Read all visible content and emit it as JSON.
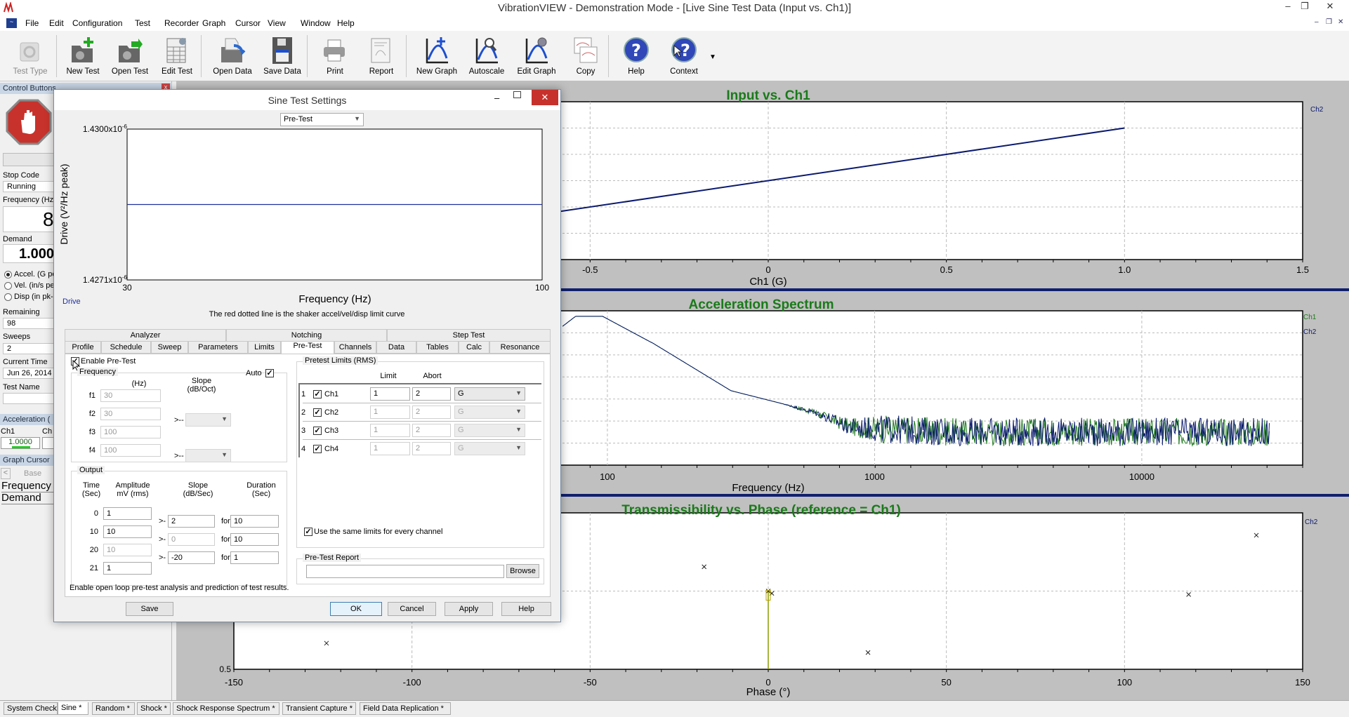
{
  "window": {
    "title": "VibrationVIEW - Demonstration Mode - [Live Sine Test Data (Input vs. Ch1)]",
    "minimize": "–",
    "restore": "❐",
    "close": "✕",
    "mdi_minimize": "–",
    "mdi_restore": "❐",
    "mdi_close": "✕"
  },
  "menu": [
    "File",
    "Edit",
    "Configuration",
    "Test",
    "Recorder",
    "Graph",
    "Cursor",
    "View",
    "Window",
    "Help"
  ],
  "toolbar": [
    {
      "label": "Test Type",
      "icon": "test-type-icon",
      "disabled": true
    },
    {
      "label": "New Test",
      "icon": "new-test-icon"
    },
    {
      "label": "Open Test",
      "icon": "open-test-icon"
    },
    {
      "label": "Edit Test",
      "icon": "edit-test-icon"
    },
    {
      "label": "Open Data",
      "icon": "open-data-icon"
    },
    {
      "label": "Save Data",
      "icon": "save-data-icon"
    },
    {
      "label": "Print",
      "icon": "printer-icon"
    },
    {
      "label": "Report",
      "icon": "report-icon"
    },
    {
      "label": "New Graph",
      "icon": "new-graph-icon"
    },
    {
      "label": "Autoscale",
      "icon": "autoscale-icon"
    },
    {
      "label": "Edit Graph",
      "icon": "edit-graph-icon"
    },
    {
      "label": "Copy",
      "icon": "copy-icon"
    },
    {
      "label": "Help",
      "icon": "help-icon"
    },
    {
      "label": "Context",
      "icon": "context-help-icon"
    }
  ],
  "left_panel": {
    "header": "Control Buttons",
    "run_button": "R",
    "stop_code_label": "Stop Code",
    "stop_code": "Running",
    "frequency_label": "Frequency (Hz",
    "frequency": "8",
    "demand_label": "Demand",
    "demand": "1.000",
    "radios": [
      {
        "label": "Accel. (G pe",
        "checked": true
      },
      {
        "label": "Vel. (in/s pe",
        "checked": false
      },
      {
        "label": "Disp (in pk-p",
        "checked": false
      }
    ],
    "remaining_label": "Remaining",
    "remaining": "98",
    "sweeps_label": "Sweeps",
    "sweeps": "2",
    "current_time_label": "Current Time",
    "current_time": "Jun 26, 2014",
    "test_name_label": "Test Name",
    "test_name": "",
    "acceleration_header": "Acceleration (",
    "ch1_label": "Ch1",
    "ch2_label": "Ch",
    "ch1_value": "1.0000",
    "graph_cursor_header": "Graph Cursor",
    "cursor_prev": "<",
    "cursor_base": "Base",
    "cursor_frequency": "Frequency",
    "cursor_demand": "Demand"
  },
  "colors": {
    "title_green": "#1a7a1a",
    "ch1": "#1f7a1f",
    "ch2": "#0b1a6e",
    "cursor_line": "#8a9a00",
    "green_bar": "#22cc22"
  },
  "chart_data": [
    {
      "type": "line",
      "title": "Input vs. Ch1",
      "xlabel": "Ch1 (G)",
      "ylabel": "",
      "xlim": [
        -1.5,
        1.5
      ],
      "ylim": [
        -1.5,
        1.5
      ],
      "xticks": [
        "-0.5",
        "0",
        "0.5",
        "1.0",
        "1.5"
      ],
      "xtick_values": [
        -0.5,
        0,
        0.5,
        1.0,
        1.5
      ],
      "grid": true,
      "series": [
        {
          "name": "Ch2",
          "x": [
            -1.5,
            1.0
          ],
          "y": [
            -1.5,
            1.0
          ]
        }
      ]
    },
    {
      "type": "line",
      "title": "Acceleration Spectrum",
      "xlabel": "Frequency (Hz)",
      "ylabel": "",
      "x_scale": "log",
      "y_scale": "log",
      "xlim": [
        4,
        40000
      ],
      "ylim": [
        0.001,
        1
      ],
      "xticks": [
        "100",
        "1000",
        "10000"
      ],
      "xtick_values": [
        100,
        1000,
        10000
      ],
      "grid": true,
      "series": [
        {
          "name": "Ch1",
          "x": [
            68,
            76,
            96,
            149,
            290,
            612,
            800,
            2000,
            8000,
            30000
          ],
          "y": [
            0.5,
            0.78,
            0.78,
            0.23,
            0.028,
            0.0105,
            0.006,
            0.005,
            0.005,
            0.005
          ]
        },
        {
          "name": "Ch2",
          "x": [
            68,
            76,
            96,
            149,
            290,
            612,
            800,
            2000,
            8000,
            30000
          ],
          "y": [
            0.5,
            0.78,
            0.78,
            0.23,
            0.028,
            0.0105,
            0.006,
            0.005,
            0.005,
            0.005
          ]
        }
      ]
    },
    {
      "type": "scatter",
      "title": "Transmissibility vs. Phase (reference = Ch1)",
      "xlabel": "Phase (°)",
      "ylabel": "",
      "y_scale": "log",
      "xlim": [
        -150,
        150
      ],
      "ylim": [
        0.5,
        2
      ],
      "xticks": [
        "-150",
        "-100",
        "-50",
        "0",
        "50",
        "100",
        "150"
      ],
      "xtick_values": [
        -150,
        -100,
        -50,
        0,
        50,
        100,
        150
      ],
      "yticks": [
        "0.5"
      ],
      "ytick_values": [
        0.5
      ],
      "grid": true,
      "series": [
        {
          "name": "Ch2",
          "x": [
            -124,
            -18,
            0,
            1,
            28,
            118,
            137
          ],
          "y": [
            0.63,
            1.24,
            1.0,
            0.98,
            0.58,
            0.97,
            1.64
          ]
        }
      ],
      "cursor_phase": 0
    },
    {
      "type": "line",
      "title": "",
      "xlabel": "Frequency (Hz)",
      "ylabel": "Drive (V²/Hz peak)",
      "x_scale": "log",
      "xlim": [
        30,
        100
      ],
      "ylim": [
        1.4271e-06,
        1.43e-06
      ],
      "yticks": [
        "1.4300x10",
        "1.4271x10"
      ],
      "ytick_exp": "-6",
      "xticks": [
        "30",
        "100"
      ],
      "legend": "Drive",
      "series": [
        {
          "name": "Drive",
          "x": [
            30,
            100
          ],
          "y": [
            1.42855e-06,
            1.42855e-06
          ]
        }
      ]
    }
  ],
  "graph_legends": {
    "g1": [
      "Ch2"
    ],
    "g2": [
      "Ch1",
      "Ch2"
    ],
    "g3": [
      "Ch2"
    ]
  },
  "dialog": {
    "title": "Sine Test Settings",
    "view_select": "Pre-Test",
    "note": "The red dotted line is the shaker accel/vel/disp limit curve",
    "tabs_row1": [
      "Analyzer",
      "Notching",
      "Step Test"
    ],
    "tabs_row2": [
      "Profile",
      "Schedule",
      "Sweep",
      "Parameters",
      "Limits",
      "Pre-Test",
      "Channels",
      "Data",
      "Tables",
      "Calc",
      "Resonance"
    ],
    "active_tab": "Pre-Test",
    "enable_pretest": {
      "label": "Enable Pre-Test",
      "checked": true
    },
    "frequency": {
      "legend": "Frequency",
      "auto_label": "Auto",
      "auto_checked": true,
      "hz_header": "(Hz)",
      "slope_header": "Slope\n(dB/Oct)",
      "rows": [
        {
          "label": "f1",
          "value": "30"
        },
        {
          "label": "f2",
          "value": "30"
        },
        {
          "label": "f3",
          "value": "100"
        },
        {
          "label": "f4",
          "value": "100"
        }
      ],
      "arrow": ">--",
      "slope1": "",
      "slope2": ""
    },
    "output": {
      "legend": "Output",
      "time_header": "Time\n(Sec)",
      "amp_header": "Amplitude\nmV (rms)",
      "slope_header": "Slope\n(dB/Sec)",
      "duration_header": "Duration\n(Sec)",
      "rows": [
        {
          "time": "0",
          "amp": "1"
        },
        {
          "time": "10",
          "amp": "10"
        },
        {
          "time": "20",
          "amp": "10"
        },
        {
          "time": "21",
          "amp": "1"
        }
      ],
      "segments": [
        {
          "slope": "2",
          "duration": "10"
        },
        {
          "slope": "0",
          "duration": "10"
        },
        {
          "slope": "-20",
          "duration": "1"
        }
      ],
      "arrow": ">-",
      "for": "for"
    },
    "limits": {
      "legend": "Pretest Limits (RMS)",
      "limit_header": "Limit",
      "abort_header": "Abort",
      "rows": [
        {
          "n": "1",
          "ch": "Ch1",
          "checked": true,
          "limit": "1",
          "abort": "2",
          "unit": "G"
        },
        {
          "n": "2",
          "ch": "Ch2",
          "checked": true,
          "limit": "1",
          "abort": "2",
          "unit": "G"
        },
        {
          "n": "3",
          "ch": "Ch3",
          "checked": true,
          "limit": "1",
          "abort": "2",
          "unit": "G"
        },
        {
          "n": "4",
          "ch": "Ch4",
          "checked": true,
          "limit": "1",
          "abort": "2",
          "unit": "G"
        }
      ],
      "same_limits": {
        "label": "Use the same limits for every channel",
        "checked": true
      }
    },
    "report": {
      "legend": "Pre-Test Report",
      "path": "",
      "browse": "Browse"
    },
    "status": "Enable open loop pre-test analysis and prediction of test results.",
    "buttons": {
      "save": "Save",
      "ok": "OK",
      "cancel": "Cancel",
      "apply": "Apply",
      "help": "Help"
    }
  },
  "bottom_tabs": [
    {
      "label": "System Check"
    },
    {
      "label": "Sine *",
      "active": true
    },
    {
      "label": "Random *"
    },
    {
      "label": "Shock *"
    },
    {
      "label": "Shock Response Spectrum *"
    },
    {
      "label": "Transient Capture *"
    },
    {
      "label": "Field Data Replication *"
    }
  ]
}
